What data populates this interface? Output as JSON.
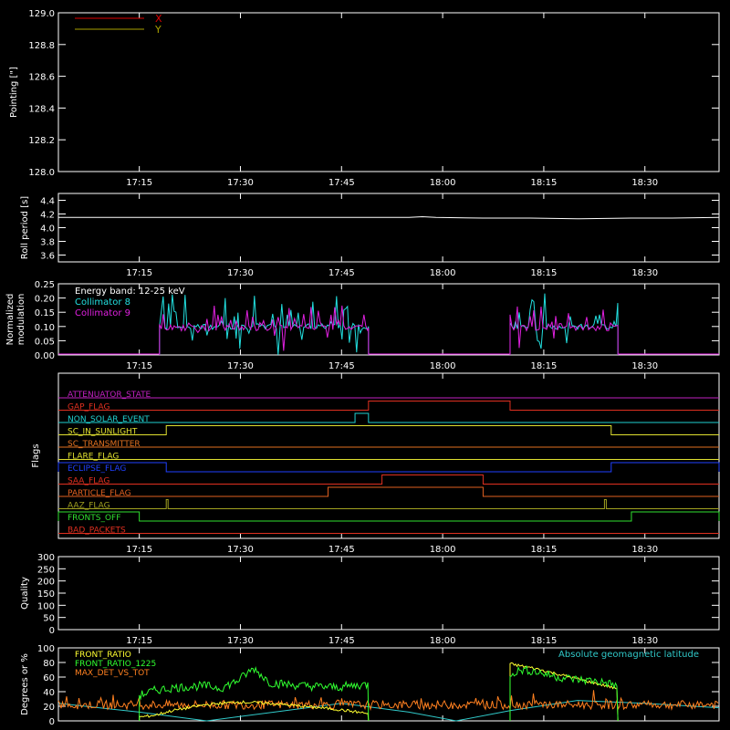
{
  "colors": {
    "background": "#000000",
    "axes": "#ffffff",
    "x": "#e00000",
    "y": "#a8a000",
    "cyan": "#22e0e0",
    "magenta": "#e020e0",
    "yellow": "#ffff30",
    "green": "#30ff30",
    "orange": "#ff8020",
    "geomag": "#30c8c8"
  },
  "time_axis": {
    "start": "17:03",
    "end": "18:41",
    "ticks": [
      "17:15",
      "17:30",
      "17:45",
      "18:00",
      "18:15",
      "18:30"
    ]
  },
  "chart_data": [
    {
      "id": "pointing",
      "type": "line",
      "ylabel": "Pointing [\"]",
      "ylim": [
        128.0,
        129.0
      ],
      "yticks": [
        "128.0",
        "128.2",
        "128.4",
        "128.6",
        "128.8",
        "129.0"
      ],
      "legend_placement": "top-left",
      "series": [
        {
          "name": "X",
          "color_key": "x",
          "points": []
        },
        {
          "name": "Y",
          "color_key": "y",
          "points": []
        }
      ]
    },
    {
      "id": "roll",
      "type": "line",
      "ylabel": "Roll period [s]",
      "ylim": [
        3.5,
        4.5
      ],
      "yticks": [
        "3.6",
        "3.8",
        "4.0",
        "4.2",
        "4.4"
      ],
      "series": [
        {
          "color_key": "axes",
          "points": [
            [
              "17:03",
              4.15
            ],
            [
              "17:55",
              4.15
            ],
            [
              "17:57",
              4.16
            ],
            [
              "17:59",
              4.15
            ],
            [
              "18:06",
              4.14
            ],
            [
              "18:13",
              4.14
            ],
            [
              "18:20",
              4.13
            ],
            [
              "18:28",
              4.14
            ],
            [
              "18:34",
              4.14
            ],
            [
              "18:41",
              4.15
            ]
          ]
        }
      ]
    },
    {
      "id": "modulation",
      "type": "line",
      "ylabel": "Normalized modulation",
      "ylim": [
        0,
        0.25
      ],
      "yticks": [
        "0.00",
        "0.05",
        "0.10",
        "0.15",
        "0.20",
        "0.25"
      ],
      "annotation": "Energy band: 12-25 keV",
      "legend_placement": "top-left",
      "series": [
        {
          "name": "Collimator 8",
          "color_key": "cyan",
          "active": [
            [
              "17:18",
              "17:49"
            ],
            [
              "18:10",
              "18:26"
            ]
          ],
          "level": 0.1
        },
        {
          "name": "Collimator 9",
          "color_key": "magenta",
          "active": [
            [
              "17:18",
              "17:49"
            ],
            [
              "18:10",
              "18:26"
            ]
          ],
          "level": 0.095
        }
      ]
    },
    {
      "id": "flags",
      "type": "line",
      "ylabel": "Flags",
      "rows": [
        {
          "name": "ATTENUATOR_STATE",
          "color": "#c020c0",
          "segments": []
        },
        {
          "name": "GAP_FLAG",
          "color": "#e03020",
          "segments": [
            [
              "17:49",
              "18:10"
            ]
          ]
        },
        {
          "name": "NON_SOLAR_EVENT",
          "color": "#20d0d0",
          "segments": [
            [
              "17:47",
              "17:49"
            ]
          ]
        },
        {
          "name": "SC_IN_SUNLIGHT",
          "color": "#e0e030",
          "segments": [
            [
              "17:19",
              "18:25"
            ]
          ]
        },
        {
          "name": "SC_TRANSMITTER",
          "color": "#e07020",
          "segments": []
        },
        {
          "name": "FLARE_FLAG",
          "color": "#e0e030",
          "segments": []
        },
        {
          "name": "ECLIPSE_FLAG",
          "color": "#2040ff",
          "segments": [
            [
              "17:03",
              "17:19"
            ],
            [
              "18:25",
              "18:41"
            ]
          ]
        },
        {
          "name": "SAA_FLAG",
          "color": "#e03020",
          "segments": [
            [
              "17:51",
              "18:06"
            ]
          ]
        },
        {
          "name": "PARTICLE_FLAG",
          "color": "#e06020",
          "segments": [
            [
              "17:43",
              "18:06"
            ]
          ]
        },
        {
          "name": "AAZ_FLAG",
          "color": "#a0a020",
          "segments": [
            [
              "17:19",
              "17:19"
            ],
            [
              "18:24",
              "18:24"
            ]
          ]
        },
        {
          "name": "FRONTS_OFF",
          "color": "#30e030",
          "segments": [
            [
              "17:03",
              "17:15"
            ],
            [
              "18:28",
              "18:41"
            ]
          ]
        },
        {
          "name": "BAD_PACKETS",
          "color": "#e03020",
          "segments": []
        }
      ]
    },
    {
      "id": "quality",
      "type": "line",
      "ylabel": "Quality",
      "ylim": [
        0,
        300
      ],
      "yticks": [
        "0",
        "50",
        "100",
        "150",
        "200",
        "250",
        "300"
      ],
      "series": []
    },
    {
      "id": "ratios",
      "type": "line",
      "ylabel": "Degrees or %",
      "ylim": [
        0,
        100
      ],
      "yticks": [
        "0",
        "20",
        "40",
        "60",
        "80",
        "100"
      ],
      "legend_placement": "top-left",
      "right_label": "Absolute geomagnetic latitude",
      "series": [
        {
          "name": "FRONT_RATIO",
          "color_key": "yellow",
          "segments": [
            {
              "start": "17:15",
              "end": "17:49",
              "values": [
                5,
                8,
                14,
                18,
                22,
                24,
                26,
                25,
                24,
                22,
                20,
                18,
                16,
                13,
                10
              ]
            },
            {
              "start": "18:10",
              "end": "18:26",
              "values": [
                78,
                75,
                72,
                68,
                64,
                60,
                56,
                52,
                48,
                44
              ]
            }
          ]
        },
        {
          "name": "FRONT_RATIO_1225",
          "color_key": "green",
          "segments": [
            {
              "start": "17:15",
              "end": "17:49",
              "values": [
                35,
                42,
                45,
                47,
                48,
                45,
                55,
                72,
                52,
                50,
                48,
                47,
                46,
                48,
                50
              ]
            },
            {
              "start": "18:10",
              "end": "18:26",
              "values": [
                65,
                70,
                68,
                64,
                60,
                58,
                56,
                55,
                52,
                48
              ]
            }
          ]
        },
        {
          "name": "MAX_DET_VS_TOT",
          "color_key": "orange",
          "segments": [
            {
              "start": "17:03",
              "end": "18:41",
              "level": 22
            }
          ]
        },
        {
          "name": "Absolute geomagnetic latitude",
          "color_key": "geomag",
          "points": [
            [
              "17:03",
              24
            ],
            [
              "17:15",
              12
            ],
            [
              "17:25",
              0
            ],
            [
              "17:35",
              12
            ],
            [
              "17:45",
              24
            ],
            [
              "17:55",
              12
            ],
            [
              "18:02",
              0
            ],
            [
              "18:10",
              14
            ],
            [
              "18:20",
              28
            ],
            [
              "18:30",
              24
            ],
            [
              "18:41",
              18
            ]
          ]
        }
      ]
    }
  ]
}
